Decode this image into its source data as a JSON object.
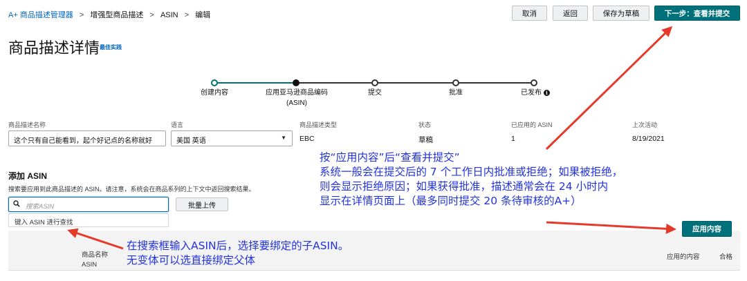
{
  "breadcrumb": {
    "items": [
      "A+ 商品描述管理器",
      "增强型商品描述",
      "ASIN",
      "编辑"
    ],
    "separator": ">"
  },
  "toolbar": {
    "cancel_label": "取消",
    "back_label": "返回",
    "save_draft_label": "保存为草稿",
    "next_label": "下一步：查看并提交"
  },
  "page": {
    "title": "商品描述详情",
    "best_practice_link": "最佳实践"
  },
  "stepper": {
    "steps": [
      {
        "label": "创建内容",
        "state": "done"
      },
      {
        "label": "应用亚马逊商品编码",
        "sub": "(ASIN)",
        "state": "current"
      },
      {
        "label": "提交",
        "state": "future"
      },
      {
        "label": "批准",
        "state": "future"
      },
      {
        "label": "已发布",
        "state": "future",
        "info_icon": "info-icon"
      }
    ]
  },
  "details": {
    "name_label": "商品描述名称",
    "name_value": "这个只有自己能看到，起个好记点的名称就好",
    "language_label": "语言",
    "language_value": "美国 英语",
    "type_label": "商品描述类型",
    "type_value": "EBC",
    "status_label": "状态",
    "status_value": "草稿",
    "applied_asin_label": "已应用的 ASIN",
    "applied_asin_value": "1",
    "last_activity_label": "上次活动",
    "last_activity_value": "8/19/2021"
  },
  "add_asin": {
    "title": "添加 ASIN",
    "description": "搜索要应用到此商品描述的 ASIN。请注意，系统会在商品系列的上下文中返回搜索结果。",
    "search_placeholder": "搜索ASIN",
    "search_icon": "search-icon",
    "bulk_upload_label": "批量上传",
    "dropdown_hint": "键入 ASIN 进行查找",
    "apply_button_label": "应用内容"
  },
  "table": {
    "col_product_name": "商品名称",
    "col_asin": "ASIN",
    "col_applied_content": "应用的内容",
    "col_eligible": "合格"
  },
  "annotations": {
    "main_lines": [
      "按“应用内容”后“查看并提交”",
      "系统一般会在提交后的 7 个工作日内批准或拒绝；如果被拒绝，",
      "则会显示拒绝原因；如果获得批准，描述通常会在 24 小时内",
      "显示在详情页面上（最多同时提交 20 条待审核的A+）"
    ],
    "search_lines": [
      "在搜索框输入ASIN后，选择要绑定的子ASIN。",
      "无变体可以选直接绑定父体"
    ],
    "color": "#2233dd",
    "arrow_color": "#e53a2a"
  },
  "colors": {
    "primary": "#00717a",
    "link": "#0066c0"
  }
}
